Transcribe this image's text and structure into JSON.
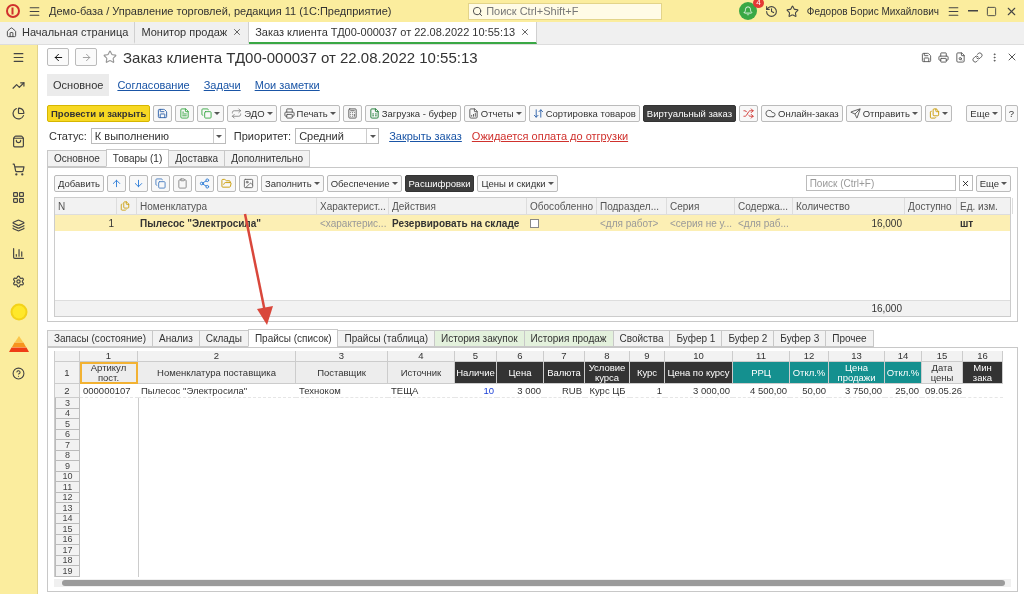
{
  "window": {
    "title": "Демо-база / Управление торговлей, редакция 11  (1С:Предприятие)",
    "search": {
      "placeholder": "Поиск Ctrl+Shift+F"
    },
    "notifications": "4",
    "user": "Федоров Борис Михайлович"
  },
  "open_tabs": [
    {
      "label": "Начальная страница",
      "kind": "home",
      "selected": false
    },
    {
      "label": "Монитор продаж",
      "kind": "closable",
      "selected": false
    },
    {
      "label": "Заказ клиента ТД00-000037 от 22.08.2022 10:55:13",
      "kind": "closable",
      "selected": true
    }
  ],
  "document": {
    "title": "Заказ клиента ТД00-000037 от 22.08.2022 10:55:13",
    "sections": [
      {
        "label": "Основное",
        "selected": true
      },
      {
        "label": "Согласование",
        "selected": false
      },
      {
        "label": "Задачи",
        "selected": false
      },
      {
        "label": "Мои заметки",
        "selected": false
      }
    ],
    "toolbar": [
      {
        "kind": "primary",
        "label": "Провести и закрыть",
        "menu": false
      },
      {
        "kind": "icon",
        "menu": false
      },
      {
        "kind": "icon",
        "menu": false
      },
      {
        "kind": "icon",
        "menu": true
      },
      {
        "kind": "button",
        "label": "ЭДО",
        "menu": true
      },
      {
        "kind": "button",
        "label": "Печать",
        "menu": true
      },
      {
        "kind": "icon",
        "menu": false
      },
      {
        "kind": "button",
        "label": "Загрузка - буфер",
        "menu": false
      },
      {
        "kind": "button",
        "label": "Отчеты",
        "menu": true
      },
      {
        "kind": "button",
        "label": "Сортировка товаров",
        "menu": false
      },
      {
        "kind": "dark",
        "label": "Виртуальный заказ",
        "menu": false
      },
      {
        "kind": "icon",
        "menu": false
      },
      {
        "kind": "button",
        "label": "Онлайн-заказ",
        "menu": false
      },
      {
        "kind": "button",
        "label": "Отправить",
        "menu": true
      },
      {
        "kind": "icon",
        "menu": true
      }
    ],
    "toolbar_right": [
      {
        "label": "Еще",
        "menu": true
      },
      {
        "label": "?",
        "menu": false
      }
    ],
    "status": {
      "label": "Статус:",
      "value": "К выполнению"
    },
    "priority": {
      "label": "Приоритет:",
      "value": "Средний"
    },
    "links": [
      {
        "label": "Закрыть заказ",
        "kind": "link"
      },
      {
        "label": "Ожидается оплата до отгрузки",
        "kind": "warning"
      }
    ],
    "form_tabs": [
      {
        "label": "Основное",
        "selected": false
      },
      {
        "label": "Товары (1)",
        "selected": true
      },
      {
        "label": "Доставка",
        "selected": false
      },
      {
        "label": "Дополнительно",
        "selected": false
      }
    ]
  },
  "goods": {
    "toolbar": [
      {
        "kind": "button",
        "label": "Добавить",
        "menu": false
      },
      {
        "kind": "icon",
        "menu": false
      },
      {
        "kind": "icon",
        "menu": false
      },
      {
        "kind": "icon",
        "menu": false
      },
      {
        "kind": "icon",
        "menu": false
      },
      {
        "kind": "icon",
        "menu": false
      },
      {
        "kind": "icon",
        "menu": false
      },
      {
        "kind": "icon",
        "menu": false
      },
      {
        "kind": "button",
        "label": "Заполнить",
        "menu": true
      },
      {
        "kind": "button",
        "label": "Обеспечение",
        "menu": true
      },
      {
        "kind": "dark",
        "label": "Расшифровки",
        "menu": false
      },
      {
        "kind": "button",
        "label": "Цены и скидки",
        "menu": true
      }
    ],
    "search": {
      "placeholder": "Поиск (Ctrl+F)"
    },
    "more": {
      "label": "Еще"
    },
    "columns": [
      "N",
      "Номенклатура",
      "Характерист...",
      "Действия",
      "Обособленно",
      "Подраздел...",
      "Серия",
      "Содержа...",
      "Количество",
      "Доступно",
      "Ед. изм."
    ],
    "rows": [
      {
        "n": "1",
        "name": "Пылесос \"Электросила\"",
        "characteristic": "<характерис...",
        "action": "Резервировать на складе",
        "separate": false,
        "department": "<для работ>",
        "series": "<серия не у...",
        "content": "<для раб...",
        "quantity": "16,000",
        "unit": "шт",
        "selected": true
      }
    ],
    "totals": {
      "quantity": "16,000"
    }
  },
  "bottom_tabs": [
    {
      "label": "Запасы (состояние)",
      "selected": false,
      "color": "#f2f2f2"
    },
    {
      "label": "Анализ",
      "selected": false,
      "color": "#f2f2f2"
    },
    {
      "label": "Склады",
      "selected": false,
      "color": "#f2f2f2"
    },
    {
      "label": "Прайсы (список)",
      "selected": true,
      "color": "#ffffff"
    },
    {
      "label": "Прайсы (таблица)",
      "selected": false,
      "color": "#f2f2f2"
    },
    {
      "label": "История закупок",
      "selected": false,
      "color": "#e3f1dc"
    },
    {
      "label": "История продаж",
      "selected": false,
      "color": "#e3f1dc"
    },
    {
      "label": "Свойства",
      "selected": false,
      "color": "#f2f2f2"
    },
    {
      "label": "Буфер 1",
      "selected": false,
      "color": "#f2f2f2"
    },
    {
      "label": "Буфер 2",
      "selected": false,
      "color": "#f2f2f2"
    },
    {
      "label": "Буфер 3",
      "selected": false,
      "color": "#f2f2f2"
    },
    {
      "label": "Прочее",
      "selected": false,
      "color": "#f2f2f2"
    }
  ],
  "sheet": {
    "column_numbers": [
      "1",
      "2",
      "3",
      "4",
      "5",
      "6",
      "7",
      "8",
      "9",
      "10",
      "11",
      "12",
      "13",
      "14",
      "15",
      "16"
    ],
    "header_row_number": "1",
    "headers": [
      {
        "label": "Артикул пост.",
        "kind": "plain",
        "selected": true
      },
      {
        "label": "Номенклатура поставщика",
        "kind": "plain",
        "selected": false
      },
      {
        "label": "Поставщик",
        "kind": "plain",
        "selected": false
      },
      {
        "label": "Источник",
        "kind": "plain",
        "selected": false
      },
      {
        "label": "Наличие",
        "kind": "dark",
        "selected": false
      },
      {
        "label": "Цена",
        "kind": "dark",
        "selected": false
      },
      {
        "label": "Валюта",
        "kind": "dark",
        "selected": false
      },
      {
        "label": "Условие курса",
        "kind": "dark",
        "selected": false
      },
      {
        "label": "Курс",
        "kind": "dark",
        "selected": false
      },
      {
        "label": "Цена по курсу",
        "kind": "dark",
        "selected": false
      },
      {
        "label": "РРЦ",
        "kind": "teal",
        "selected": false
      },
      {
        "label": "Откл.%",
        "kind": "teal",
        "selected": false
      },
      {
        "label": "Цена продажи",
        "kind": "teal",
        "selected": false
      },
      {
        "label": "Откл.%",
        "kind": "teal",
        "selected": false
      },
      {
        "label": "Дата цены",
        "kind": "plain",
        "selected": false
      },
      {
        "label": "Мин зака",
        "kind": "dark",
        "selected": false
      }
    ],
    "rows": [
      {
        "number": "2",
        "cells": [
          "000000107",
          "Пылесос \"Электросила\"",
          "Техноком",
          "ТЕЩА",
          "10",
          "3 000",
          "RUB",
          "Курс ЦБ",
          "1",
          "3 000,00",
          "4 500,00",
          "50,00",
          "3 750,00",
          "25,00",
          "09.05.26"
        ]
      }
    ],
    "empty_rows": [
      "3",
      "4",
      "5",
      "6",
      "7",
      "8",
      "9",
      "10",
      "11",
      "12",
      "13",
      "14",
      "15",
      "16",
      "17",
      "18",
      "19"
    ]
  }
}
